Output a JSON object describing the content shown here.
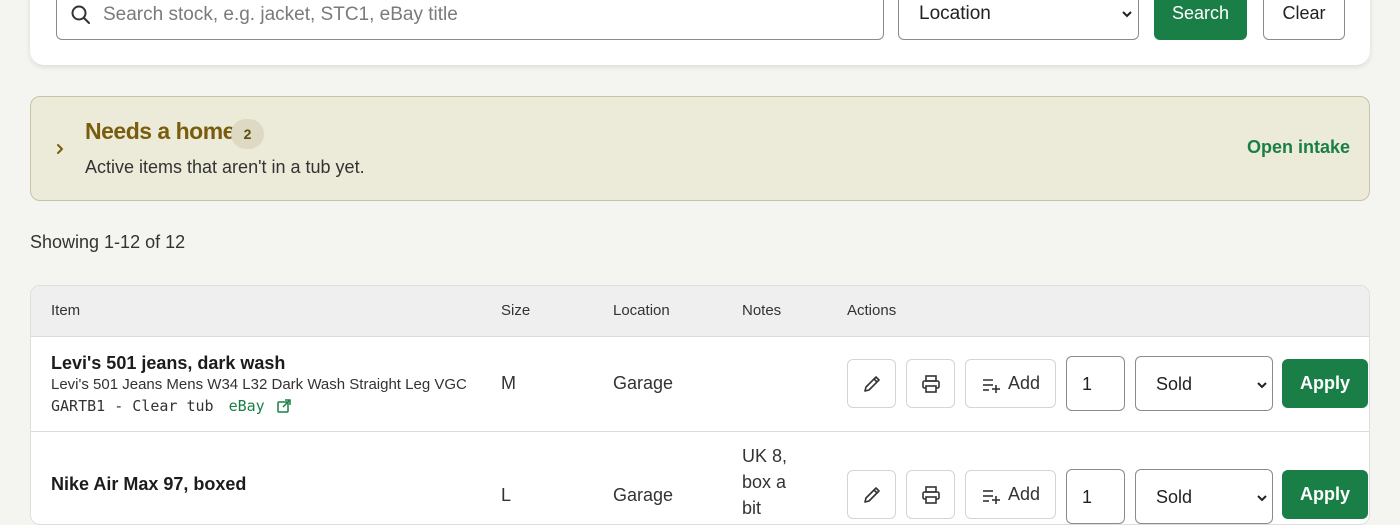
{
  "search": {
    "placeholder": "Search stock, e.g. jacket, STC1, eBay title",
    "location_value": "Location",
    "search_label": "Search",
    "clear_label": "Clear"
  },
  "needs_home": {
    "title": "Needs a home",
    "count": "2",
    "subtitle": "Active items that aren't in a tub yet.",
    "action_label": "Open intake"
  },
  "showing_text": "Showing 1-12 of 12",
  "table": {
    "headers": [
      "Item",
      "Size",
      "Location",
      "Notes",
      "Actions"
    ],
    "rows": [
      {
        "title": "Levi's 501 jeans, dark wash",
        "description": "Levi's 501 Jeans Mens W34 L32 Dark Wash Straight Leg VGC",
        "meta": "GARTB1 - Clear tub",
        "ebay_label": "eBay",
        "size": "M",
        "location": "Garage",
        "notes": "",
        "add_label": "Add",
        "qty": "1",
        "status": "Sold",
        "apply_label": "Apply"
      },
      {
        "title": "Nike Air Max 97, boxed",
        "description": "",
        "meta": "",
        "ebay_label": "",
        "size": "L",
        "location": "Garage",
        "notes": "UK 8, box a bit",
        "add_label": "Add",
        "qty": "1",
        "status": "Sold",
        "apply_label": "Apply"
      }
    ]
  },
  "colors": {
    "accent_green": "#1a7f46",
    "home_title": "#7a5d0c",
    "home_panel_bg": "#ecead9"
  }
}
